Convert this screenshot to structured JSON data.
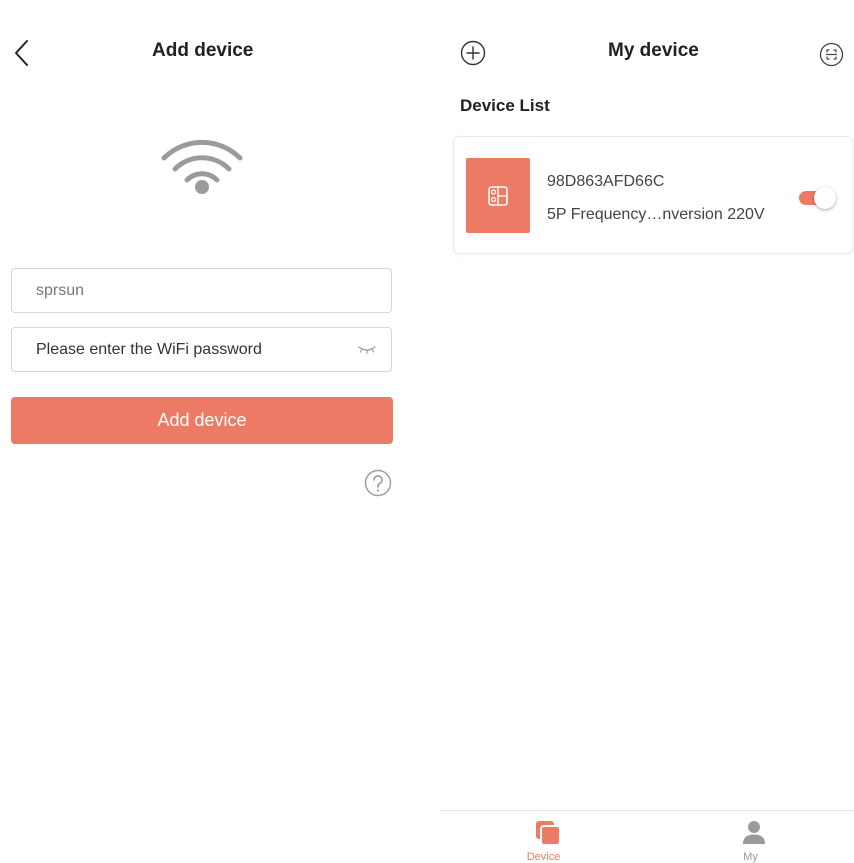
{
  "colors": {
    "accent": "#ec7a64",
    "text": "#222222",
    "muted": "#999999",
    "border": "#d6d6d6"
  },
  "add_device_screen": {
    "title": "Add device",
    "icons": {
      "back": "chevron-left-icon",
      "wifi": "wifi-icon",
      "password_visibility": "eye-closed-icon",
      "help": "question-circle-icon"
    },
    "ssid_field": {
      "value": "sprsun"
    },
    "password_field": {
      "value": "",
      "placeholder": "Please enter the WiFi password"
    },
    "submit_label": "Add device"
  },
  "my_device_screen": {
    "title": "My device",
    "icons": {
      "add": "plus-circle-icon",
      "scan": "scan-icon"
    },
    "section_title": "Device List",
    "devices": [
      {
        "id": "98D863AFD66C",
        "model": "5P Frequency…nversion 220V",
        "power_on": true,
        "icon": "thermostat-panel-icon"
      }
    ],
    "tabs": [
      {
        "label": "Device",
        "icon": "device-stack-icon",
        "active": true
      },
      {
        "label": "My",
        "icon": "user-icon",
        "active": false
      }
    ]
  }
}
